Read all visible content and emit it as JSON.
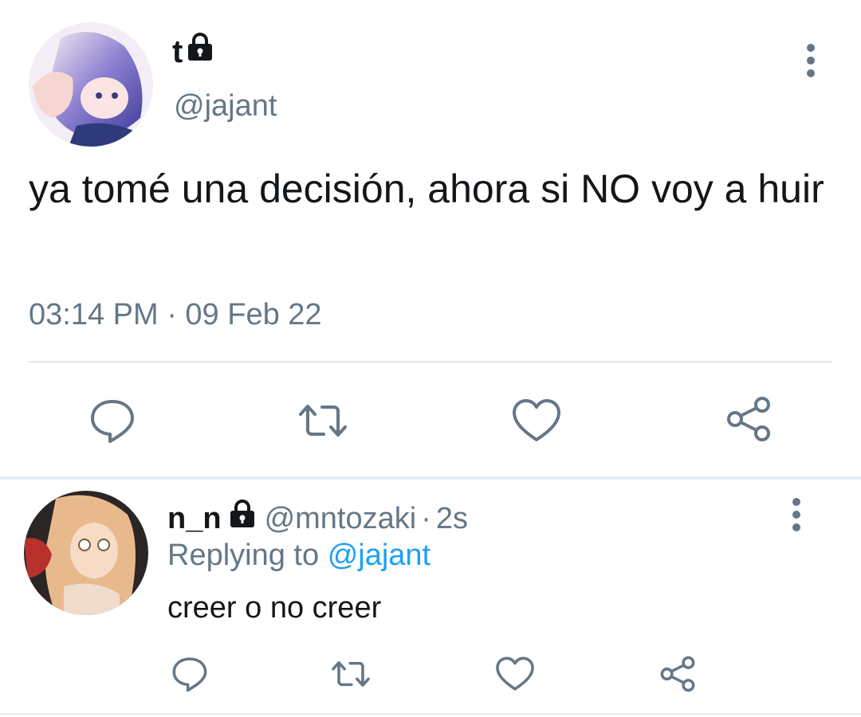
{
  "tweet": {
    "display_name": "t",
    "handle": "@jajant",
    "text": "ya tomé una decisión, ahora si NO voy a huir",
    "timestamp": "03:14 PM · 09 Feb 22",
    "actions": [
      "reply-icon",
      "retweet-icon",
      "like-icon",
      "share-icon"
    ]
  },
  "reply": {
    "display_name": "n_n",
    "handle": "@mntozaki",
    "separator": "·",
    "time": "2s",
    "replying_prefix": "Replying to",
    "replying_mention": "@jajant",
    "text": "creer o no creer",
    "actions": [
      "reply-icon",
      "retweet-icon",
      "like-icon",
      "share-icon"
    ]
  },
  "colors": {
    "text_primary": "#14171a",
    "text_secondary": "#657786",
    "accent": "#1da1f2",
    "icon": "#657786",
    "divider": "#e1e8ed"
  }
}
